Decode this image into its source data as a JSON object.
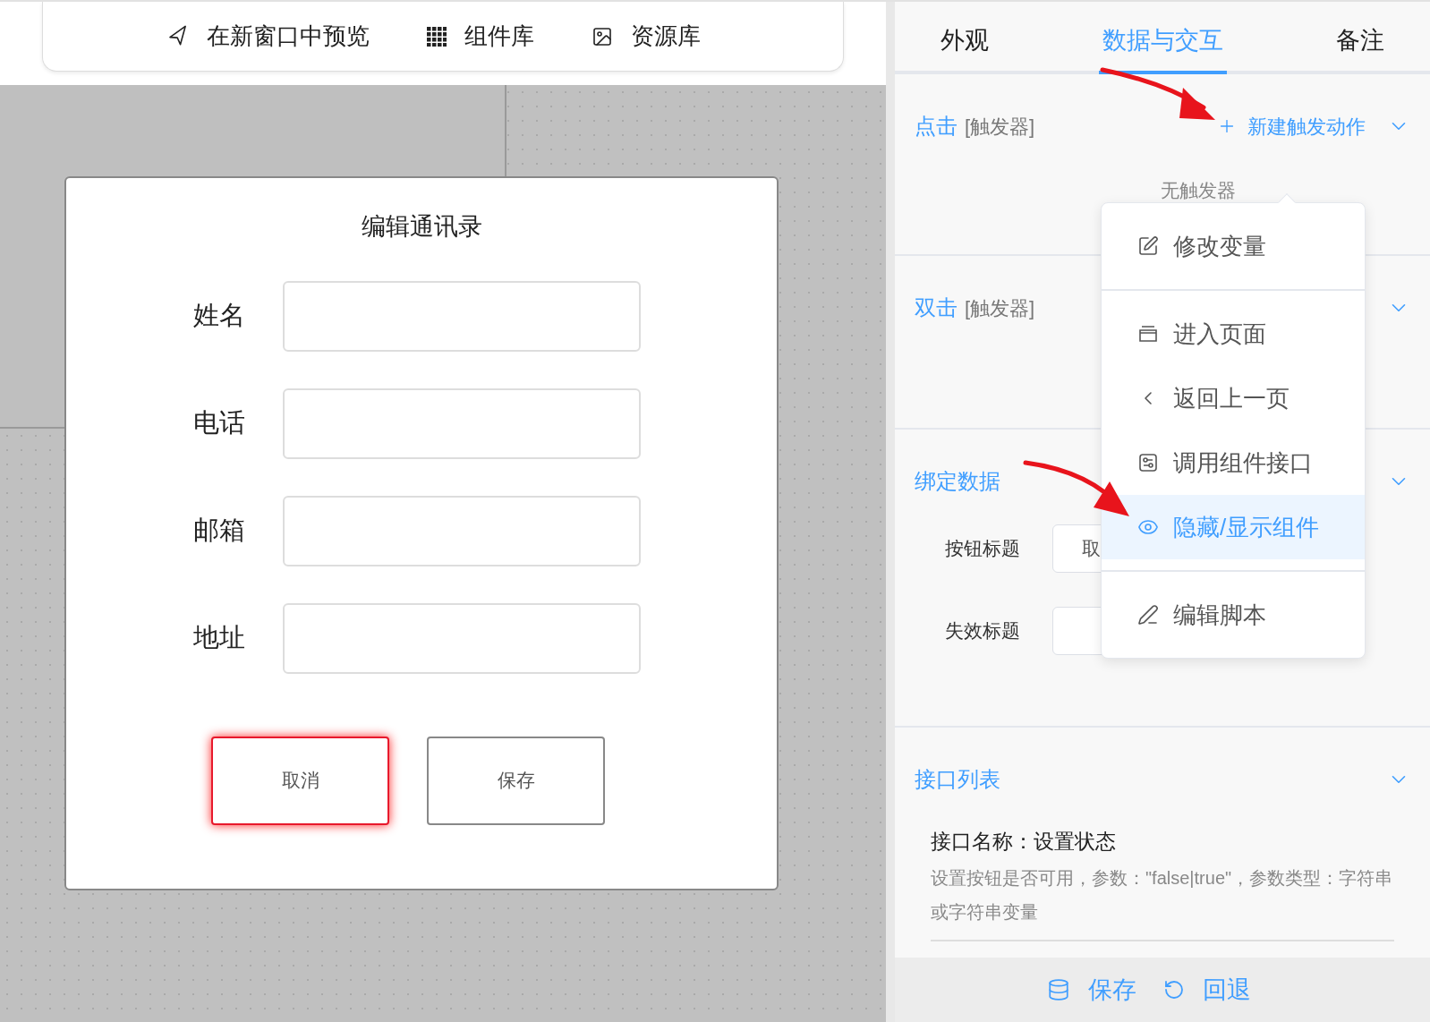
{
  "toolbar": [
    {
      "label": "在新窗口中预览",
      "kind": "navigate"
    },
    {
      "label": "组件库",
      "kind": "grid"
    },
    {
      "label": "资源库",
      "kind": "image"
    }
  ],
  "dialog": {
    "title": "编辑通讯录",
    "fields": [
      {
        "label": "姓名"
      },
      {
        "label": "电话"
      },
      {
        "label": "邮箱"
      },
      {
        "label": "地址"
      }
    ],
    "buttons": [
      {
        "label": "取消",
        "selected": true
      },
      {
        "label": "保存",
        "selected": false
      }
    ]
  },
  "panel": {
    "tabs": [
      {
        "label": "外观",
        "selected": false
      },
      {
        "label": "数据与交互",
        "selected": true
      },
      {
        "label": "备注",
        "selected": false
      }
    ],
    "sections": [
      {
        "kind": "trigger",
        "title": "点击",
        "tag": "[触发器]",
        "action": "新建触发动作",
        "empty_text": "无触发器"
      },
      {
        "kind": "trigger",
        "title": "双击",
        "tag": "[触发器]"
      },
      {
        "kind": "binding",
        "title": "绑定数据",
        "rows": [
          {
            "label": "按钮标题",
            "value": "取"
          },
          {
            "label": "失效标题"
          }
        ]
      },
      {
        "kind": "api",
        "title": "接口列表",
        "name": "接口名称：设置状态",
        "description": "设置按钮是否可用，参数：\"false|true\"，参数类型：字符串或字符串变量"
      }
    ],
    "menu": [
      [
        {
          "label": "修改变量",
          "kind": "edit",
          "selected": false
        }
      ],
      [
        {
          "label": "进入页面",
          "kind": "page",
          "selected": false
        },
        {
          "label": "返回上一页",
          "kind": "back",
          "selected": false
        },
        {
          "label": "调用组件接口",
          "kind": "api",
          "selected": false
        },
        {
          "label": "隐藏/显示组件",
          "kind": "eye",
          "selected": true
        }
      ],
      [
        {
          "label": "编辑脚本",
          "kind": "script",
          "selected": false
        }
      ]
    ],
    "footer": [
      {
        "label": "保存",
        "kind": "save"
      },
      {
        "label": "回退",
        "kind": "undo"
      }
    ]
  }
}
